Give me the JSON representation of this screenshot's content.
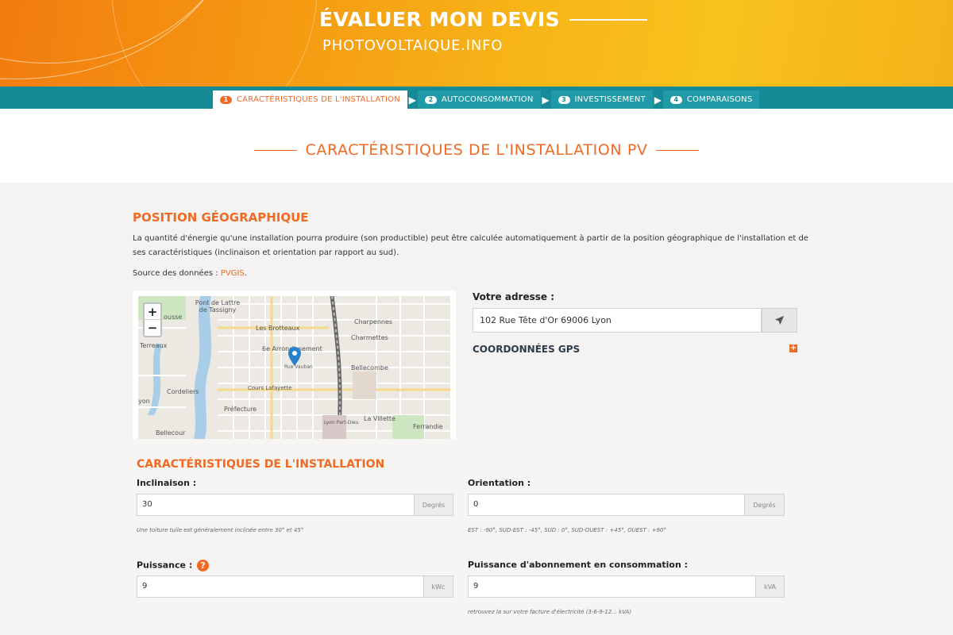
{
  "header": {
    "title": "ÉVALUER MON DEVIS",
    "subtitle": "PHOTOVOLTAIQUE.INFO"
  },
  "steps": [
    {
      "num": "1",
      "label": "CARACTÉRISTIQUES DE L'INSTALLATION",
      "active": true
    },
    {
      "num": "2",
      "label": "AUTOCONSOMMATION",
      "active": false
    },
    {
      "num": "3",
      "label": "INVESTISSEMENT",
      "active": false
    },
    {
      "num": "4",
      "label": "COMPARAISONS",
      "active": false
    }
  ],
  "page_title": "CARACTÉRISTIQUES DE L'INSTALLATION PV",
  "position": {
    "heading": "POSITION GÉOGRAPHIQUE",
    "paragraph": "La quantité d'énergie qu'une installation pourra produire (son productible) peut être calculée automatiquement à partir de la position géographique de l'installation et de ses caractéristiques (inclinaison et orientation par rapport au sud).",
    "source_prefix": "Source des données : ",
    "source_link": "PVGIS",
    "source_suffix": "."
  },
  "map": {
    "zoom_in": "+",
    "zoom_out": "−",
    "labels": [
      "Pont de Lattre de Tassigny",
      "Les Brotteaux",
      "6e Arrondissement",
      "Rue Vauban",
      "Cours Lafayette",
      "Charpennes",
      "Charmettes",
      "Bellecombe",
      "Terreaux",
      "Cordeliers",
      "Préfecture",
      "La Villette",
      "Lyon Part-Dieu",
      "Ferrandie",
      "Bellecour",
      "yon",
      "ousse"
    ]
  },
  "address": {
    "label": "Votre adresse :",
    "value": "102 Rue Tête d'Or 69006 Lyon",
    "locate_icon": "location-arrow-icon"
  },
  "gps": {
    "label": "COORDONNÉES GPS",
    "expand_icon": "plus-icon"
  },
  "installation": {
    "heading": "CARACTÉRISTIQUES DE L'INSTALLATION",
    "inclinaison": {
      "label": "Inclinaison :",
      "value": "30",
      "unit": "Degrés",
      "hint": "Une toiture tuile est généralement inclinée entre 30° et 45°"
    },
    "orientation": {
      "label": "Orientation :",
      "value": "0",
      "unit": "Degrés",
      "hint": "EST : -90°, SUD-EST : -45°, SUD : 0°, SUD-OUEST : +45°, OUEST : +90°"
    },
    "puissance": {
      "label": "Puissance :",
      "value": "9",
      "unit": "kWc",
      "help": "?"
    },
    "abonnement": {
      "label": "Puissance d'abonnement en consommation :",
      "value": "9",
      "unit": "kVA",
      "hint": "retrouvez la sur votre facture d'électricité (3-6-9-12... kVA)"
    }
  },
  "colors": {
    "accent": "#f06a24",
    "teal": "#168b97",
    "header_gradient_start": "#f27c0f",
    "header_gradient_end": "#f8c21c"
  }
}
